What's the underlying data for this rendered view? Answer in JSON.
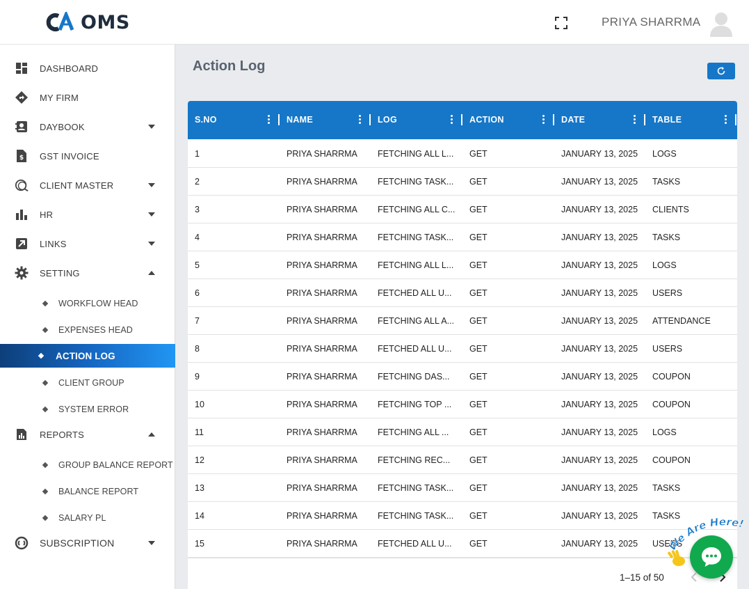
{
  "header": {
    "logo_text": "OMS",
    "user_name": "PRIYA SHARRMA"
  },
  "sidebar": {
    "items": [
      {
        "label": "DASHBOARD",
        "icon": "dashboard-icon"
      },
      {
        "label": "MY FIRM",
        "icon": "firm-icon"
      },
      {
        "label": "DAYBOOK",
        "icon": "daybook-icon",
        "expandable": true
      },
      {
        "label": "GST INVOICE",
        "icon": "invoice-icon"
      },
      {
        "label": "CLIENT MASTER",
        "icon": "client-master-icon",
        "expandable": true
      },
      {
        "label": "HR",
        "icon": "bar-chart-icon",
        "expandable": true
      },
      {
        "label": "LINKS",
        "icon": "link-icon",
        "expandable": true
      },
      {
        "label": "SETTING",
        "icon": "gear-icon",
        "expanded": true
      },
      {
        "label": "REPORTS",
        "icon": "report-icon",
        "expanded": true
      },
      {
        "label": "SUBSCRIPTION",
        "icon": "subscription-icon",
        "expandable": true
      }
    ],
    "setting_sub": [
      {
        "label": "WORKFLOW HEAD"
      },
      {
        "label": "EXPENSES HEAD"
      },
      {
        "label": "ACTION LOG",
        "active": true
      },
      {
        "label": "CLIENT GROUP"
      },
      {
        "label": "SYSTEM ERROR"
      }
    ],
    "reports_sub": [
      {
        "label": "GROUP BALANCE REPORT"
      },
      {
        "label": "BALANCE REPORT"
      },
      {
        "label": "SALARY PL"
      }
    ]
  },
  "main": {
    "title": "Action Log",
    "table": {
      "columns": [
        "S.NO",
        "NAME",
        "LOG",
        "ACTION",
        "DATE",
        "TABLE"
      ],
      "rows": [
        [
          "1",
          "PRIYA SHARRMA",
          "FETCHING ALL L...",
          "GET",
          "JANUARY 13, 2025",
          "LOGS"
        ],
        [
          "2",
          "PRIYA SHARRMA",
          "FETCHING TASK...",
          "GET",
          "JANUARY 13, 2025",
          "TASKS"
        ],
        [
          "3",
          "PRIYA SHARRMA",
          "FETCHING ALL C...",
          "GET",
          "JANUARY 13, 2025",
          "CLIENTS"
        ],
        [
          "4",
          "PRIYA SHARRMA",
          "FETCHING TASK...",
          "GET",
          "JANUARY 13, 2025",
          "TASKS"
        ],
        [
          "5",
          "PRIYA SHARRMA",
          "FETCHING ALL L...",
          "GET",
          "JANUARY 13, 2025",
          "LOGS"
        ],
        [
          "6",
          "PRIYA SHARRMA",
          "FETCHED ALL U...",
          "GET",
          "JANUARY 13, 2025",
          "USERS"
        ],
        [
          "7",
          "PRIYA SHARRMA",
          "FETCHING ALL A...",
          "GET",
          "JANUARY 13, 2025",
          "ATTENDANCE"
        ],
        [
          "8",
          "PRIYA SHARRMA",
          "FETCHED ALL U...",
          "GET",
          "JANUARY 13, 2025",
          "USERS"
        ],
        [
          "9",
          "PRIYA SHARRMA",
          "FETCHING DAS...",
          "GET",
          "JANUARY 13, 2025",
          "COUPON"
        ],
        [
          "10",
          "PRIYA SHARRMA",
          "FETCHING TOP ...",
          "GET",
          "JANUARY 13, 2025",
          "COUPON"
        ],
        [
          "11",
          "PRIYA SHARRMA",
          "FETCHING ALL ...",
          "GET",
          "JANUARY 13, 2025",
          "LOGS"
        ],
        [
          "12",
          "PRIYA SHARRMA",
          "FETCHING REC...",
          "GET",
          "JANUARY 13, 2025",
          "COUPON"
        ],
        [
          "13",
          "PRIYA SHARRMA",
          "FETCHING TASK...",
          "GET",
          "JANUARY 13, 2025",
          "TASKS"
        ],
        [
          "14",
          "PRIYA SHARRMA",
          "FETCHING TASK...",
          "GET",
          "JANUARY 13, 2025",
          "TASKS"
        ],
        [
          "15",
          "PRIYA SHARRMA",
          "FETCHED ALL U...",
          "GET",
          "JANUARY 13, 2025",
          "USERS"
        ]
      ]
    },
    "pagination": {
      "range_text": "1–15 of 50"
    }
  },
  "chat": {
    "tagline": "We Are Here!"
  },
  "colors": {
    "primary": "#1677c8",
    "active_gradient_start": "#0d3f7a",
    "active_gradient_end": "#2196f3",
    "chat_green": "#11a94e"
  }
}
